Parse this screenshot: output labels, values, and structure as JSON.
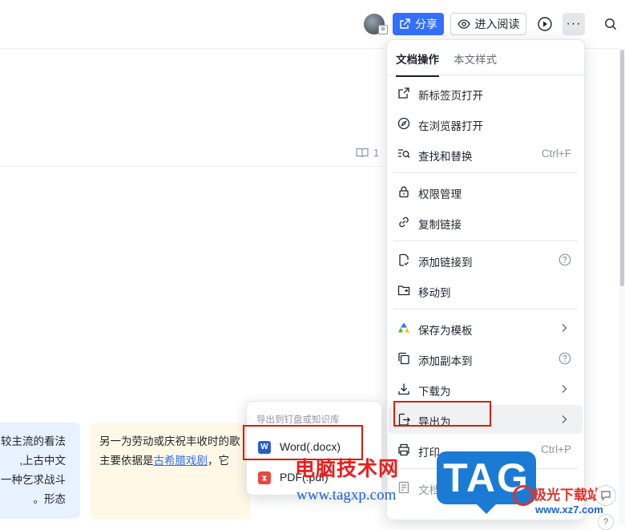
{
  "header": {
    "share_label": "分享",
    "read_label": "进入阅读",
    "more_label": "···"
  },
  "document": {
    "read_count": "1",
    "blue_card_lines": [
      "较主流的看法",
      "上古中文,",
      "一种乞求战斗",
      "形态。"
    ],
    "yellow_card_line1": "另一为劳动或庆祝丰收时的歌",
    "yellow_card_line2_prefix": "主要依据是",
    "yellow_card_link": "古希腊戏剧",
    "yellow_card_line2_suffix": "，它"
  },
  "menu": {
    "tabs": [
      {
        "label": "文档操作",
        "active": true
      },
      {
        "label": "本文样式",
        "active": false
      }
    ],
    "items": [
      {
        "label": "新标签页打开",
        "icon": "new-tab-icon"
      },
      {
        "label": "在浏览器打开",
        "icon": "compass-icon"
      },
      {
        "label": "查找和替换",
        "icon": "find-replace-icon",
        "shortcut": "Ctrl+F"
      },
      {
        "label": "权限管理",
        "icon": "lock-icon"
      },
      {
        "label": "复制链接",
        "icon": "link-icon"
      },
      {
        "label": "添加链接到",
        "icon": "add-link-icon",
        "help": true
      },
      {
        "label": "移动到",
        "icon": "folder-move-icon"
      },
      {
        "label": "保存为模板",
        "icon": "template-icon",
        "submenu": true
      },
      {
        "label": "添加副本到",
        "icon": "copy-icon",
        "help": true
      },
      {
        "label": "下载为",
        "icon": "download-icon",
        "submenu": true
      },
      {
        "label": "导出为",
        "icon": "export-icon",
        "submenu": true
      },
      {
        "label": "打印",
        "icon": "print-icon",
        "shortcut": "Ctrl+P"
      },
      {
        "label": "文档信息",
        "icon": "info-icon"
      }
    ]
  },
  "export_submenu": {
    "title": "导出到钉盘或知识库",
    "items": [
      {
        "label": "Word(.docx)",
        "icon": "word-icon",
        "color": "#2b5ccf"
      },
      {
        "label": "PDF(.pdf)",
        "icon": "pdf-icon",
        "color": "#e8483d"
      }
    ]
  },
  "watermark": {
    "cn_text": "电脑技术网",
    "url": "www.tagxp.com",
    "tag": "TAG",
    "site_cn": "极光下载站",
    "site_url": "www.xz7.com"
  },
  "colors": {
    "accent": "#3370ff",
    "highlight_box": "#d81e06"
  }
}
